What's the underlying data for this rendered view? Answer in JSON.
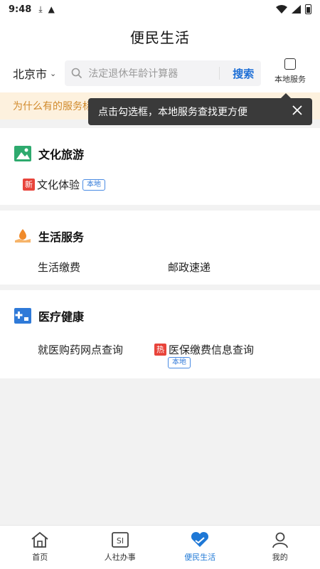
{
  "status_bar": {
    "time": "9:48"
  },
  "header": {
    "title": "便民生活"
  },
  "search": {
    "city": "北京市",
    "placeholder": "法定退休年龄计算器",
    "button": "搜索",
    "local_toggle_label": "本地服务"
  },
  "notice": {
    "text": "为什么有的服务标"
  },
  "tooltip": {
    "text": "点击勾选框，本地服务查找更方便"
  },
  "sections": [
    {
      "title": "文化旅游",
      "services": [
        {
          "label": "文化体验",
          "badge": "新",
          "tag": "本地"
        }
      ]
    },
    {
      "title": "生活服务",
      "services": [
        {
          "label": "生活缴费"
        },
        {
          "label": "邮政速递"
        }
      ]
    },
    {
      "title": "医疗健康",
      "services": [
        {
          "label": "就医购药网点查询"
        },
        {
          "label": "医保缴费信息查询",
          "badge": "热",
          "tag": "本地"
        }
      ]
    }
  ],
  "tabs": [
    {
      "label": "首页",
      "icon": "home-icon"
    },
    {
      "label": "人社办事",
      "icon": "si-icon"
    },
    {
      "label": "便民生活",
      "icon": "heart-hand-icon",
      "active": true
    },
    {
      "label": "我的",
      "icon": "person-icon"
    }
  ],
  "colors": {
    "accent": "#1e78d6",
    "badge_red": "#e8443b",
    "notice_bg": "#fdf1de",
    "notice_text": "#d18a2c"
  }
}
